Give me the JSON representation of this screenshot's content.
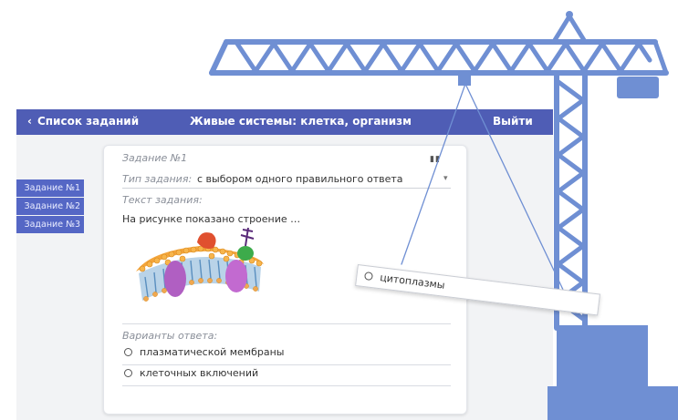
{
  "header": {
    "back_label": "Список заданий",
    "title": "Живые системы: клетка, организм",
    "logout_label": "Выйти"
  },
  "sidebar": {
    "tabs": [
      "Задание №1",
      "Задание №2",
      "Задание №3"
    ]
  },
  "task": {
    "number_label": "Задание №1",
    "type_label": "Тип задания:",
    "type_value": "с выбором одного правильного ответа",
    "text_label": "Текст задания:",
    "text_value": "На рисунке показано строение …",
    "answers_label": "Варианты ответа:",
    "answers": [
      "плазматической мембраны",
      "клеточных включений"
    ]
  },
  "hanging_answer": {
    "label": "цитоплазмы"
  },
  "colors": {
    "accent": "#4f5db5",
    "crane": "#6f8fd3"
  }
}
